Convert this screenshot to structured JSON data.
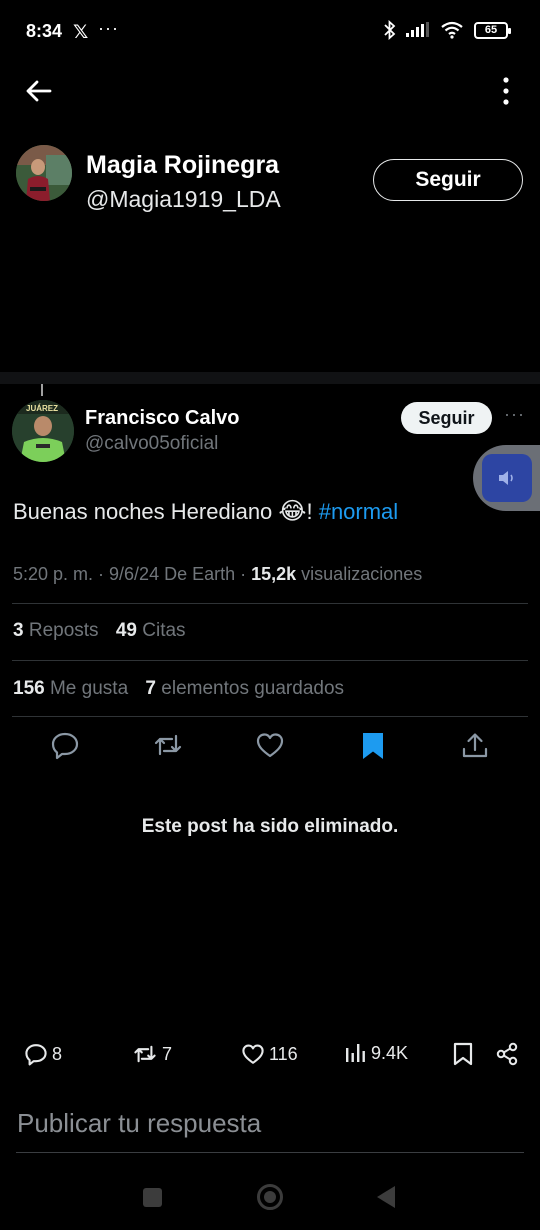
{
  "status_bar": {
    "time": "8:34",
    "app_icon": "x-logo-icon",
    "more_notifications": "···",
    "battery": "65"
  },
  "top_bar": {
    "back_icon": "arrow-left-icon",
    "more_icon": "vertical-dots-icon"
  },
  "profile": {
    "name": "Magia Rojinegra",
    "handle": "@Magia1919_LDA",
    "follow_label": "Seguir"
  },
  "tweet": {
    "author_name": "Francisco Calvo",
    "author_handle": "@calvo05oficial",
    "follow_label": "Seguir",
    "more": "···",
    "text": "Buenas noches Herediano ",
    "emoji": "😂",
    "text_after_emoji": "! ",
    "hashtag": "#normal",
    "meta_prefix": "5:20 p. m. · 9/6/24 De Earth · ",
    "views_count": "15,2k",
    "views_label": " visualizaciones",
    "reposts_count": "3",
    "reposts_label": "Reposts",
    "quotes_count": "49",
    "quotes_label": "Citas",
    "likes_count": "156",
    "likes_label": "Me gusta",
    "bookmarks_count": "7",
    "bookmarks_label": "elementos guardados"
  },
  "actions": {
    "reply_icon": "reply-icon",
    "repost_icon": "repost-icon",
    "like_icon": "heart-icon",
    "bookmark_icon": "bookmark-icon",
    "share_icon": "share-icon",
    "bookmark_color": "#1d9bf0"
  },
  "deleted_notice": "Este post ha sido eliminado.",
  "bottom_bar": {
    "replies": "8",
    "reposts": "7",
    "likes": "116",
    "views": "9.4K"
  },
  "reply_placeholder": "Publicar tu respuesta",
  "colors": {
    "background": "#000000",
    "accent": "#1d9bf0",
    "muted": "#71767b"
  }
}
